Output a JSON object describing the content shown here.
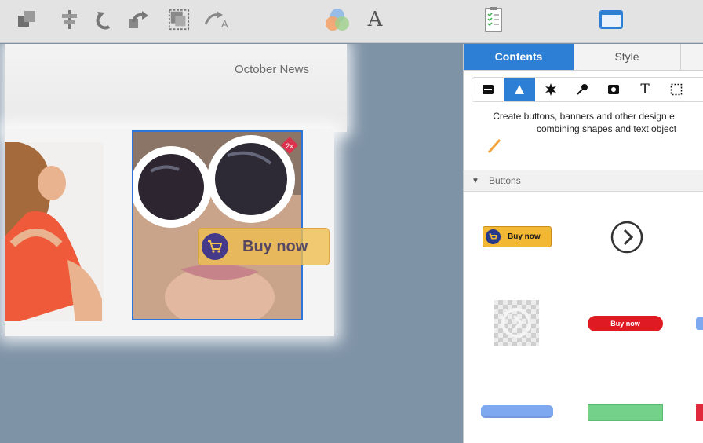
{
  "canvas": {
    "header_text": "October News",
    "overlay_button_label": "Buy now",
    "badge_label": "2x"
  },
  "toolbar": {
    "icons": [
      "arrange-icon",
      "align-icon",
      "undo-icon",
      "redo-icon",
      "resize-icon",
      "text-path-icon",
      "color-icon",
      "font-icon",
      "checklist-icon",
      "panel-icon"
    ],
    "font_glyph": "A",
    "text_path_glyph": "A"
  },
  "panel": {
    "tabs": [
      {
        "label": "Contents",
        "active": true
      },
      {
        "label": "Style",
        "active": false
      }
    ],
    "shape_buttons": [
      "banner-icon",
      "triangle-icon",
      "burst-icon",
      "pin-icon",
      "video-icon",
      "text-icon",
      "selection-icon"
    ],
    "text_glyph": "T",
    "description_line1": "Create buttons, banners and other design e",
    "description_line2": "combining shapes and text object",
    "section_title": "Buttons",
    "gallery": {
      "buy_now_yellow": "Buy now",
      "buy_now_red": "Buy now"
    }
  },
  "colors": {
    "accent": "#2d7fd5",
    "canvas_bg": "#7f93a7",
    "button_red": "#e01a22",
    "button_yellow": "#f2b733",
    "button_blue": "#7ea8f0",
    "button_green": "#74d18a"
  }
}
